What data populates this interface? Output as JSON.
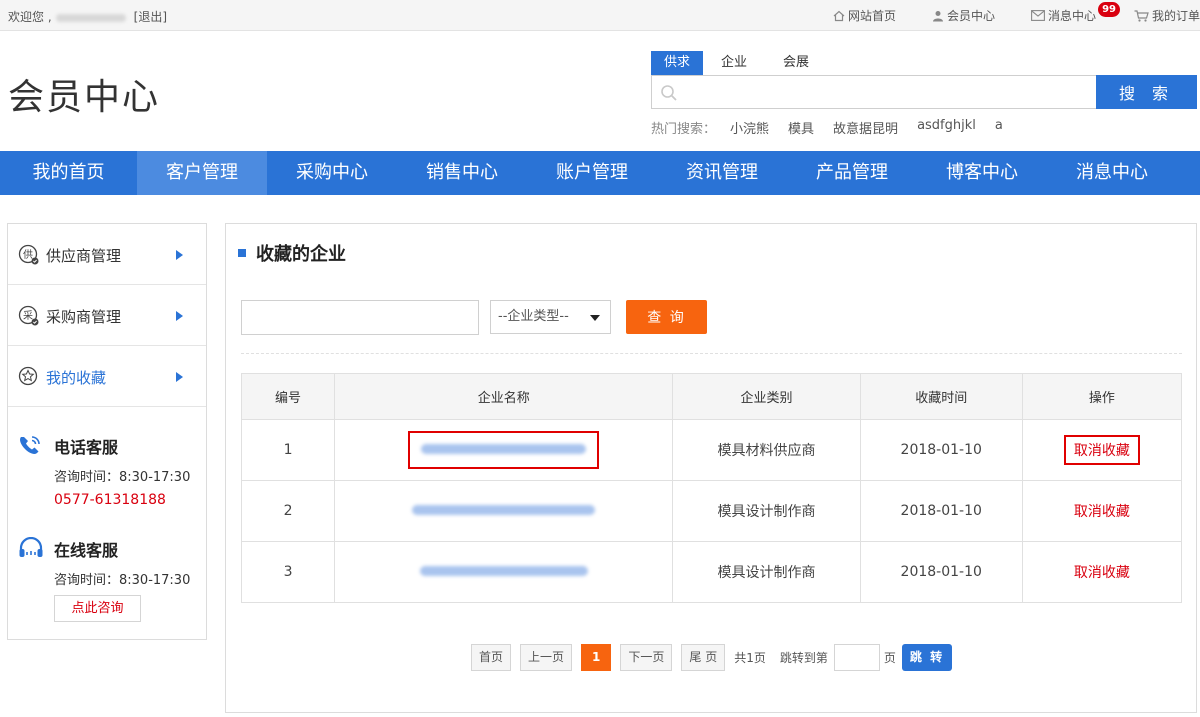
{
  "topbar": {
    "welcome": "欢迎您 ,",
    "logout": "[退出]",
    "links": [
      {
        "label": "网站首页",
        "icon": "home-icon"
      },
      {
        "label": "会员中心",
        "icon": "user-icon"
      },
      {
        "label": "消息中心",
        "icon": "mail-icon",
        "badge": "99"
      },
      {
        "label": "我的订单",
        "icon": "cart-icon"
      }
    ]
  },
  "header": {
    "title": "会员中心",
    "search_tabs": [
      "供求",
      "企业",
      "会展"
    ],
    "search_button": "搜 索",
    "hot_label": "热门搜索：",
    "hot_items": [
      "小浣熊",
      "模具",
      "故意据昆明",
      "asdfghjkl",
      "a"
    ]
  },
  "nav": [
    "我的首页",
    "客户管理",
    "采购中心",
    "销售中心",
    "账户管理",
    "资讯管理",
    "产品管理",
    "博客中心",
    "消息中心"
  ],
  "sidebar": {
    "menu": [
      {
        "label": "供应商管理",
        "icon_char": "供"
      },
      {
        "label": "采购商管理",
        "icon_char": "采"
      },
      {
        "label": "我的收藏",
        "icon_char": "☆"
      }
    ],
    "phone_service": {
      "title": "电话客服",
      "time": "咨询时间：8:30-17:30",
      "phone": "0577-61318188"
    },
    "online_service": {
      "title": "在线客服",
      "time": "咨询时间：8:30-17:30",
      "button": "点此咨询"
    }
  },
  "main": {
    "title": "收藏的企业",
    "filter": {
      "select": "--企业类型--",
      "query_button": "查 询"
    },
    "table": {
      "headers": [
        "编号",
        "企业名称",
        "企业类别",
        "收藏时间",
        "操作"
      ],
      "rows": [
        {
          "no": "1",
          "category": "模具材料供应商",
          "date": "2018-01-10",
          "action": "取消收藏"
        },
        {
          "no": "2",
          "category": "模具设计制作商",
          "date": "2018-01-10",
          "action": "取消收藏"
        },
        {
          "no": "3",
          "category": "模具设计制作商",
          "date": "2018-01-10",
          "action": "取消收藏"
        }
      ]
    },
    "pager": {
      "first": "首页",
      "prev": "上一页",
      "current": "1",
      "next": "下一页",
      "last": "尾 页",
      "total": "共1页",
      "jump_label": "跳转到第",
      "page_suffix": "页",
      "go": "跳 转"
    }
  },
  "colors": {
    "primary": "#2a73d6",
    "accent": "#f7640f",
    "danger": "#d9000f"
  }
}
